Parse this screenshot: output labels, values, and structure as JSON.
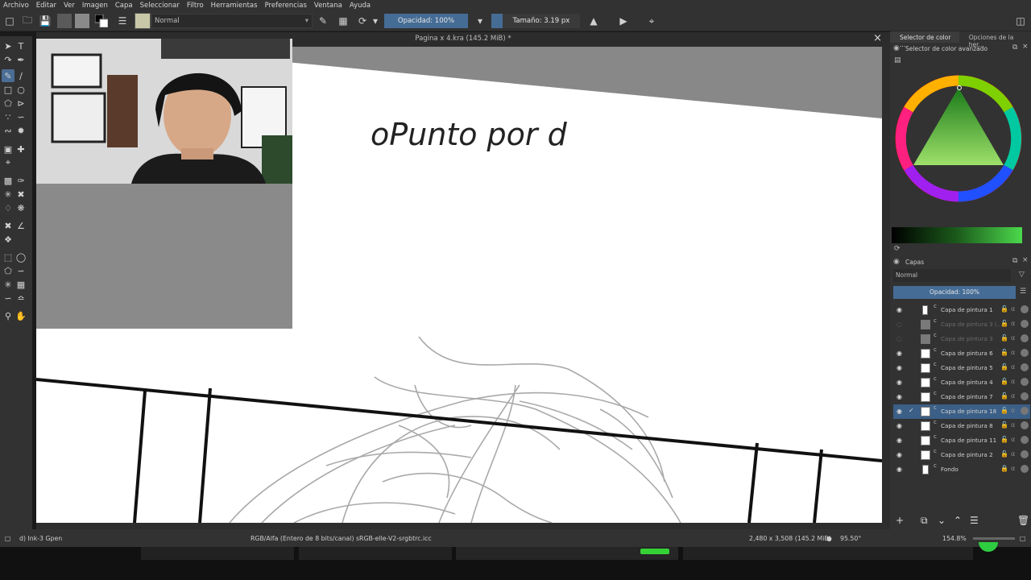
{
  "menu": [
    "Archivo",
    "Editar",
    "Ver",
    "Imagen",
    "Capa",
    "Seleccionar",
    "Filtro",
    "Herramientas",
    "Preferencias",
    "Ventana",
    "Ayuda"
  ],
  "toolbar": {
    "blend_mode": "Normal",
    "opacity_label": "Opacidad: 100%",
    "size_label": "Tamaño: 3.19 px"
  },
  "document": {
    "title": "Pagina x 4.kra (145.2 MiB) *",
    "handwriting": "oPunto por d"
  },
  "right_dock": {
    "tabs": [
      "Selector de color ...",
      "Opciones de la her..."
    ],
    "color_panel_title": "Selector de color avanzado",
    "layers_title": "Capas",
    "layer_blend": "Normal",
    "layer_opacity": "Opacidad:  100%"
  },
  "layers": [
    {
      "name": "Capa de pintura 1",
      "visible": true,
      "selected": false,
      "dim": false
    },
    {
      "name": "Capa de pintura 3 (...",
      "visible": false,
      "selected": false,
      "dim": true
    },
    {
      "name": "Capa de pintura 3",
      "visible": false,
      "selected": false,
      "dim": true
    },
    {
      "name": "Capa de pintura 6",
      "visible": true,
      "selected": false,
      "dim": false
    },
    {
      "name": "Capa de pintura 5",
      "visible": true,
      "selected": false,
      "dim": false
    },
    {
      "name": "Capa de pintura 4",
      "visible": true,
      "selected": false,
      "dim": false
    },
    {
      "name": "Capa de pintura 7",
      "visible": true,
      "selected": false,
      "dim": false
    },
    {
      "name": "Capa de pintura 18",
      "visible": true,
      "selected": true,
      "dim": false
    },
    {
      "name": "Capa de pintura 8",
      "visible": true,
      "selected": false,
      "dim": false
    },
    {
      "name": "Capa de pintura 11",
      "visible": true,
      "selected": false,
      "dim": false
    },
    {
      "name": "Capa de pintura 2",
      "visible": true,
      "selected": false,
      "dim": false
    },
    {
      "name": "Fondo",
      "visible": true,
      "selected": false,
      "dim": false,
      "locked": true
    }
  ],
  "status": {
    "brush": "d) Ink-3 Gpen",
    "color_space": "RGB/Alfa (Entero de 8 bits/canal)  sRGB-elle-V2-srgbtrc.icc",
    "dimensions": "2,480 x 3,508 (145.2 MiB)",
    "rotation": "95.50°",
    "zoom": "154.8%"
  },
  "colors": {
    "accent": "#456c95",
    "panel": "#323232",
    "selected_layer": "#3b5f86"
  }
}
